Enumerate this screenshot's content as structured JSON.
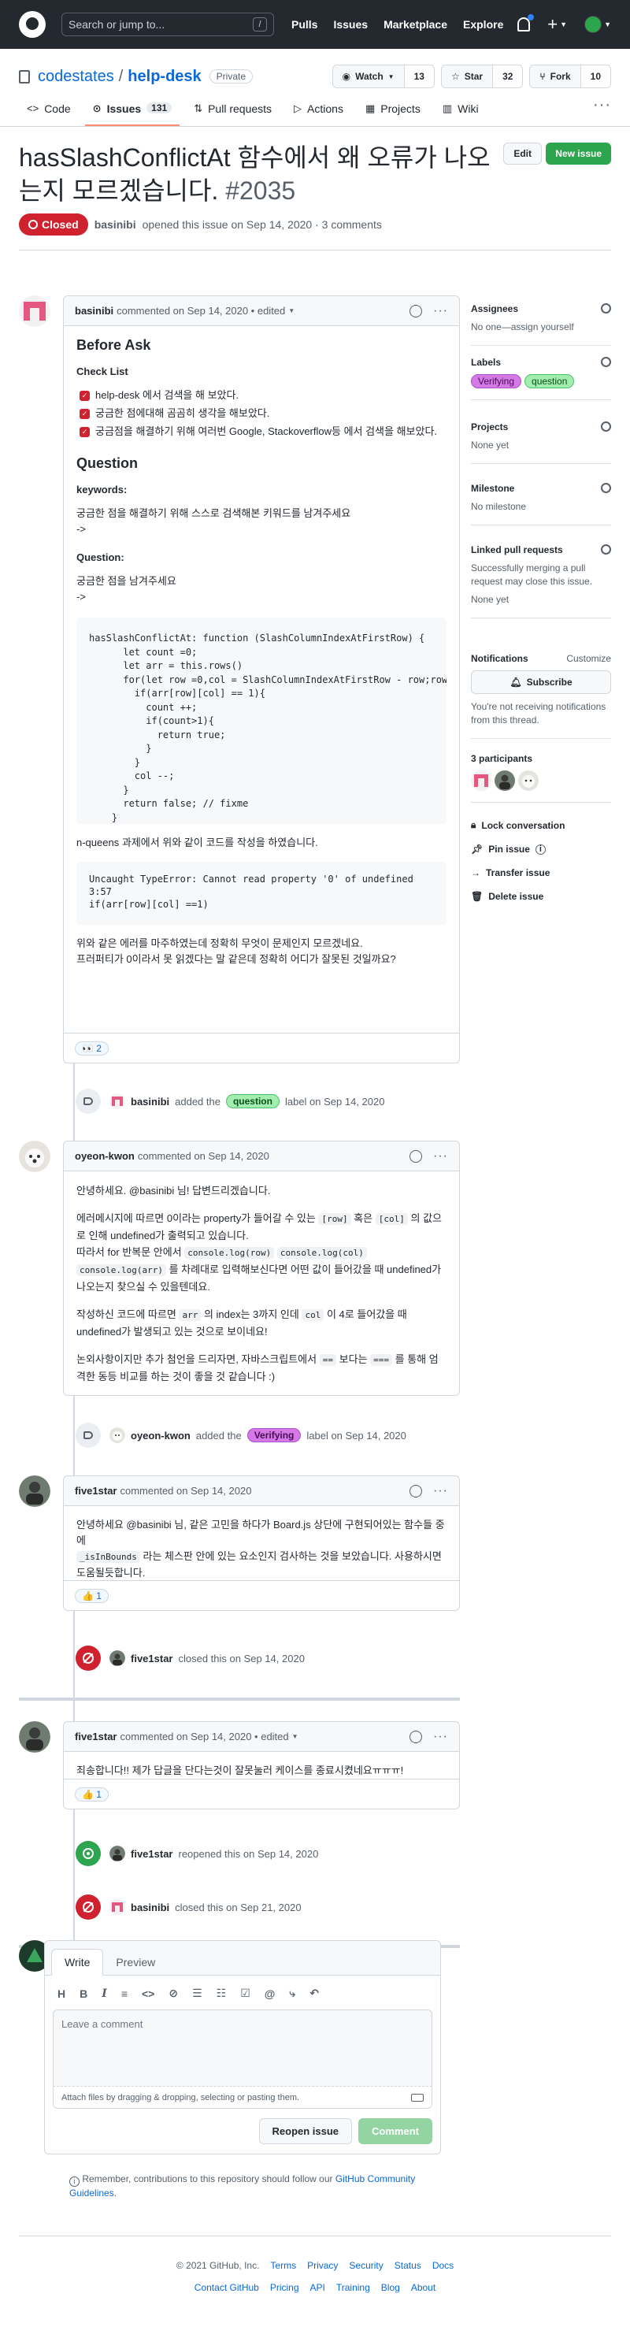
{
  "header": {
    "search_placeholder": "Search or jump to...",
    "search_key": "/",
    "nav": [
      "Pulls",
      "Issues",
      "Marketplace",
      "Explore"
    ]
  },
  "repo": {
    "owner": "codestates",
    "name": "help-desk",
    "visibility": "Private",
    "watch_label": "Watch",
    "watch_count": "13",
    "star_label": "Star",
    "star_count": "32",
    "fork_label": "Fork",
    "fork_count": "10",
    "tabs": [
      {
        "label": "Code"
      },
      {
        "label": "Issues",
        "count": "131"
      },
      {
        "label": "Pull requests"
      },
      {
        "label": "Actions"
      },
      {
        "label": "Projects"
      },
      {
        "label": "Wiki"
      }
    ]
  },
  "issue": {
    "title": "hasSlashConflictAt 함수에서 왜 오류가 나오는지 모르겠습니다.",
    "number": "#2035",
    "edit_label": "Edit",
    "new_issue_label": "New issue",
    "state": "Closed",
    "author": "basinibi",
    "opened_text": "opened this issue on Sep 14, 2020 · 3 comments"
  },
  "comments": [
    {
      "author": "basinibi",
      "meta": "commented on Sep 14, 2020 • edited",
      "before_ask": "Before Ask",
      "checklist_title": "Check List",
      "checklist": [
        "help-desk 에서 검색을 해 보았다.",
        "궁금한 점에대해 곰곰히 생각을 해보았다.",
        "궁금점을 해결하기 위해 여러번 Google, Stackoverflow등 에서 검색을 해보았다."
      ],
      "question_heading": "Question",
      "keywords_label": "keywords:",
      "keywords_text": "궁금한 점을 해결하기 위해 스스로 검색해본 키워드를 남겨주세요",
      "keywords_arrow": "->",
      "question_label": "Question:",
      "question_text": "궁금한 점을 남겨주세요",
      "question_arrow": "->",
      "code": "hasSlashConflictAt: function (SlashColumnIndexAtFirstRow) {\n      let count =0;\n      let arr = this.rows()\n      for(let row =0,col = SlashColumnIndexAtFirstRow - row;row<\n        if(arr[row][col] == 1){\n          count ++;\n          if(count>1){\n            return true;\n          }\n        }\n        col --;\n      }\n      return false; // fixme\n    }",
      "after_code": "n-queens 과제에서 위와 같이 코드를 작성을 하였습니다.",
      "error": "Uncaught TypeError: Cannot read property '0' of undefined\n3:57\nif(arr[row][col] ==1)",
      "closing_1": "위와 같은 에러를 마주하였는데 정확히 무엇이 문제인지 모르겠네요.",
      "closing_2": "프러퍼티가 0이라서 못 읽겠다는 말 같은데 정확히 어디가 잘못된 것일까요?",
      "reaction_emoji": "👀",
      "reaction_count": "2"
    },
    {
      "author": "oyeon-kwon",
      "meta": "commented on Sep 14, 2020",
      "p1": "안녕하세요. @basinibi 님! 답변드리겠습니다.",
      "p2a": "에러메시지에 따르면 0이라는 property가 들어갈 수 있는",
      "code_row": "[row]",
      "p2b": "혹은",
      "code_col": "[col]",
      "p2c": "의 값으로 인해 undefined가 출력되고 있습니다.",
      "p3a": "따라서 for 반복문 안에서",
      "code_log1": "console.log(row)",
      "code_log2": "console.log(col)",
      "code_log3": "console.log(arr)",
      "p3b": "를 차례대로 입력해보신다면 어떤 값이 들어갔을 때 undefined가 나오는지 찾으실 수 있을텐데요.",
      "p4a": "작성하신 코드에 따르면",
      "code_arr": "arr",
      "p4b": "의 index는 3까지 인데",
      "code_col2": "col",
      "p4c": "이 4로 들어갔을 때 undefined가 발생되고 있는 것으로 보이네요!",
      "p5a": "논외사항이지만 추가 첨언을 드리자면, 자바스크립트에서",
      "code_eq2": "==",
      "p5b": "보다는",
      "code_eq3": "===",
      "p5c": "를 통해 엄격한 동등 비교를 하는 것이 좋을 것 같습니다 :)"
    },
    {
      "author": "five1star",
      "meta": "commented on Sep 14, 2020",
      "p1": "안녕하세요 @basinibi 님, 같은 고민을 하다가 Board.js 상단에 구현되어있는 함수들 중에",
      "code_fn": "_isInBounds",
      "p2": "라는 체스판 안에 있는 요소인지 검사하는 것을 보았습니다. 사용하시면 도움될듯합니다.",
      "reaction_emoji": "👍",
      "reaction_count": "1"
    },
    {
      "author": "five1star",
      "meta": "commented on Sep 14, 2020 • edited",
      "p1": "죄송합니다!! 제가 답글을 단다는것이 잘못눌러 케이스를 종료시켰네요ㅠㅠㅠ!",
      "reaction_emoji": "👍",
      "reaction_count": "1"
    }
  ],
  "events": [
    {
      "actor": "basinibi",
      "pre": "added the",
      "label": "question",
      "post": "label on Sep 14, 2020"
    },
    {
      "actor": "oyeon-kwon",
      "pre": "added the",
      "label": "Verifying",
      "post": "label on Sep 14, 2020"
    },
    {
      "actor": "five1star",
      "text": "closed this on Sep 14, 2020"
    },
    {
      "actor": "five1star",
      "text": "reopened this on Sep 14, 2020"
    },
    {
      "actor": "basinibi",
      "text": "closed this on Sep 21, 2020"
    }
  ],
  "sidebar": {
    "assignees_title": "Assignees",
    "assignees_text": "No one—assign yourself",
    "labels_title": "Labels",
    "labels": [
      "Verifying",
      "question"
    ],
    "projects_title": "Projects",
    "projects_text": "None yet",
    "milestone_title": "Milestone",
    "milestone_text": "No milestone",
    "linked_title": "Linked pull requests",
    "linked_text": "Successfully merging a pull request may close this issue.",
    "linked_none": "None yet",
    "notifications_title": "Notifications",
    "customize": "Customize",
    "subscribe": "Subscribe",
    "notif_text": "You're not receiving notifications from this thread.",
    "participants_title": "3 participants",
    "lock": "Lock conversation",
    "pin": "Pin issue",
    "transfer": "Transfer issue",
    "delete": "Delete issue"
  },
  "new_comment": {
    "tab_write": "Write",
    "tab_preview": "Preview",
    "placeholder": "Leave a comment",
    "attach": "Attach files by dragging & dropping, selecting or pasting them.",
    "reopen": "Reopen issue",
    "comment": "Comment",
    "remember_pre": "Remember, contributions to this repository should follow our",
    "remember_link": "GitHub Community Guidelines",
    "remember_post": "."
  },
  "footer": {
    "copyright": "© 2021 GitHub, Inc.",
    "row1": [
      "Terms",
      "Privacy",
      "Security",
      "Status",
      "Docs"
    ],
    "row2": [
      "Contact GitHub",
      "Pricing",
      "API",
      "Training",
      "Blog",
      "About"
    ]
  },
  "colors": {
    "closed": "#cf222e",
    "open": "#2da44e",
    "link": "#0969da"
  }
}
